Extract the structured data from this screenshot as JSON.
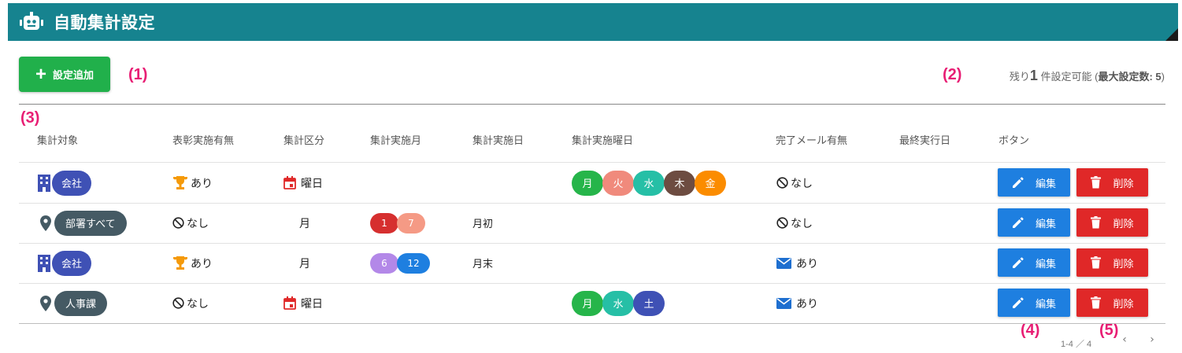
{
  "app": {
    "title": "自動集計設定",
    "header_color": "#16838f",
    "header_icon": "robot-icon"
  },
  "toolbar": {
    "add_label": "設定追加",
    "add_icon": "plus-icon",
    "add_color": "#21b04b"
  },
  "remaining": {
    "prefix": "残り",
    "count": "1",
    "middle": "件設定可能",
    "max_label": "最大設定数: 5",
    "open": "(",
    "close": ")"
  },
  "annotations": [
    "(1)",
    "(2)",
    "(3)",
    "(4)",
    "(5)"
  ],
  "columns": [
    "集計対象",
    "表彰実施有無",
    "集計区分",
    "集計実施月",
    "集計実施日",
    "集計実施曜日",
    "完了メール有無",
    "最終実行日",
    "ボタン"
  ],
  "rows": [
    {
      "target": "会社",
      "target_icon": "building-icon",
      "target_color": "#3f51b5",
      "award": "あり",
      "award_icon": "trophy-icon",
      "category": "曜日",
      "category_icon": "calendar-icon",
      "months": [],
      "day": "",
      "weekdays": [
        {
          "label": "月",
          "color": "#26b54a"
        },
        {
          "label": "火",
          "color": "#f08a7c"
        },
        {
          "label": "水",
          "color": "#26bfa6"
        },
        {
          "label": "木",
          "color": "#6d4c41"
        },
        {
          "label": "金",
          "color": "#fb8c00"
        }
      ],
      "mail": "なし",
      "mail_icon": "block-icon",
      "last_run": "",
      "edit_label": "編集",
      "delete_label": "削除"
    },
    {
      "target": "部署すべて",
      "target_icon": "location-pin-icon",
      "target_color": "#455a64",
      "award": "なし",
      "award_icon": "block-icon",
      "category": "月",
      "category_icon": "moon-icon",
      "months": [
        {
          "label": "1",
          "color": "#d62f2f"
        },
        {
          "label": "7",
          "color": "#f59a85"
        }
      ],
      "day": "月初",
      "weekdays": [],
      "mail": "なし",
      "mail_icon": "block-icon",
      "last_run": "",
      "edit_label": "編集",
      "delete_label": "削除"
    },
    {
      "target": "会社",
      "target_icon": "building-icon",
      "target_color": "#3f51b5",
      "award": "あり",
      "award_icon": "trophy-icon",
      "category": "月",
      "category_icon": "moon-icon",
      "months": [
        {
          "label": "6",
          "color": "#b388e8"
        },
        {
          "label": "12",
          "color": "#1e7fe0"
        }
      ],
      "day": "月末",
      "weekdays": [],
      "mail": "あり",
      "mail_icon": "mail-icon",
      "last_run": "",
      "edit_label": "編集",
      "delete_label": "削除"
    },
    {
      "target": "人事課",
      "target_icon": "location-pin-icon",
      "target_color": "#455a64",
      "award": "なし",
      "award_icon": "block-icon",
      "category": "曜日",
      "category_icon": "calendar-icon",
      "months": [],
      "day": "",
      "weekdays": [
        {
          "label": "月",
          "color": "#26b54a"
        },
        {
          "label": "水",
          "color": "#26bfa6"
        },
        {
          "label": "土",
          "color": "#3f51b5"
        }
      ],
      "mail": "あり",
      "mail_icon": "mail-icon",
      "last_run": "",
      "edit_label": "編集",
      "delete_label": "削除"
    }
  ],
  "pagination": {
    "range": "1-4 ／ 4",
    "prev_icon": "chevron-left-icon",
    "next_icon": "chevron-right-icon"
  },
  "colors": {
    "edit": "#1e7fe0",
    "delete": "#e02828",
    "annotation": "#e81e74"
  }
}
